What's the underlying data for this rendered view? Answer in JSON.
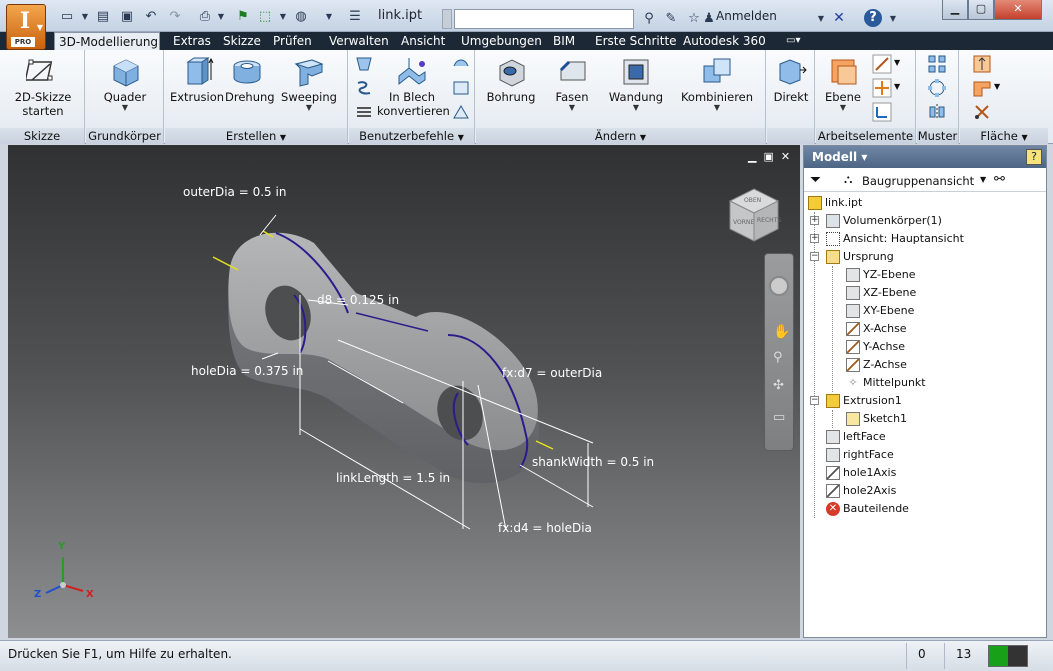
{
  "window": {
    "doc_title": "link.ipt",
    "search_placeholder": "",
    "signin_label": "Anmelden",
    "app_badge": "PRO",
    "app_letter": "I"
  },
  "tabs": [
    {
      "label": "3D-Modellierung",
      "active": true
    },
    {
      "label": "Extras"
    },
    {
      "label": "Skizze"
    },
    {
      "label": "Prüfen"
    },
    {
      "label": "Verwalten"
    },
    {
      "label": "Ansicht"
    },
    {
      "label": "Umgebungen"
    },
    {
      "label": "BIM"
    },
    {
      "label": "Erste Schritte"
    },
    {
      "label": "Autodesk 360"
    }
  ],
  "ribbon": {
    "panels": {
      "skizze": "Skizze",
      "grundkoerper": "Grundkörper",
      "erstellen": "Erstellen",
      "benutzerbefehle": "Benutzerbefehle",
      "aendern": "Ändern",
      "arbeitselemente": "Arbeitselemente",
      "muster": "Muster",
      "flaeche": "Fläche"
    },
    "buttons": {
      "skizze_line1": "2D-Skizze",
      "skizze_line2": "starten",
      "quader": "Quader",
      "extrusion": "Extrusion",
      "drehung": "Drehung",
      "sweeping": "Sweeping",
      "inblech_line1": "In Blech",
      "inblech_line2": "konvertieren",
      "bohrung": "Bohrung",
      "fasen": "Fasen",
      "wandung": "Wandung",
      "kombinieren": "Kombinieren",
      "direkt": "Direkt",
      "ebene": "Ebene"
    },
    "panel_arrows": {
      "erstellen": "▼",
      "benutzerbefehle": "▼",
      "aendern": "▼",
      "flaeche": "▼"
    }
  },
  "viewport": {
    "dims": {
      "outerDia": "outerDia = 0.5 in",
      "d8": "d8 = 0.125 in",
      "holeDia": "holeDia = 0.375 in",
      "fxd7": "fx:d7 = outerDia",
      "shankWidth": "shankWidth = 0.5 in",
      "linkLength": "linkLength = 1.5 in",
      "fxd4": "fx:d4 = holeDia"
    },
    "viewcube": {
      "top": "OBEN",
      "front": "VORNE",
      "right": "RECHTS"
    },
    "triad": {
      "x": "X",
      "y": "Y",
      "z": "Z"
    }
  },
  "browser": {
    "title": "Modell",
    "title_arrow": "▾",
    "help": "?",
    "view_label": "Baugruppenansicht",
    "view_arrow": "▼",
    "items": [
      {
        "label": "link.ipt"
      },
      {
        "label": "Volumenkörper(1)"
      },
      {
        "label": "Ansicht: Hauptansicht"
      },
      {
        "label": "Ursprung"
      },
      {
        "label": "YZ-Ebene"
      },
      {
        "label": "XZ-Ebene"
      },
      {
        "label": "XY-Ebene"
      },
      {
        "label": "X-Achse"
      },
      {
        "label": "Y-Achse"
      },
      {
        "label": "Z-Achse"
      },
      {
        "label": "Mittelpunkt"
      },
      {
        "label": "Extrusion1"
      },
      {
        "label": "Sketch1"
      },
      {
        "label": "leftFace"
      },
      {
        "label": "rightFace"
      },
      {
        "label": "hole1Axis"
      },
      {
        "label": "hole2Axis"
      },
      {
        "label": "Bauteilende"
      }
    ]
  },
  "status": {
    "hint": "Drücken Sie F1, um Hilfe zu erhalten.",
    "count1": "0",
    "count2": "13"
  },
  "colors": {
    "accent": "#f08b28",
    "tab_bar": "#1d2836",
    "sketch_line": "#2d1a8c",
    "status_green": "#18a018"
  }
}
